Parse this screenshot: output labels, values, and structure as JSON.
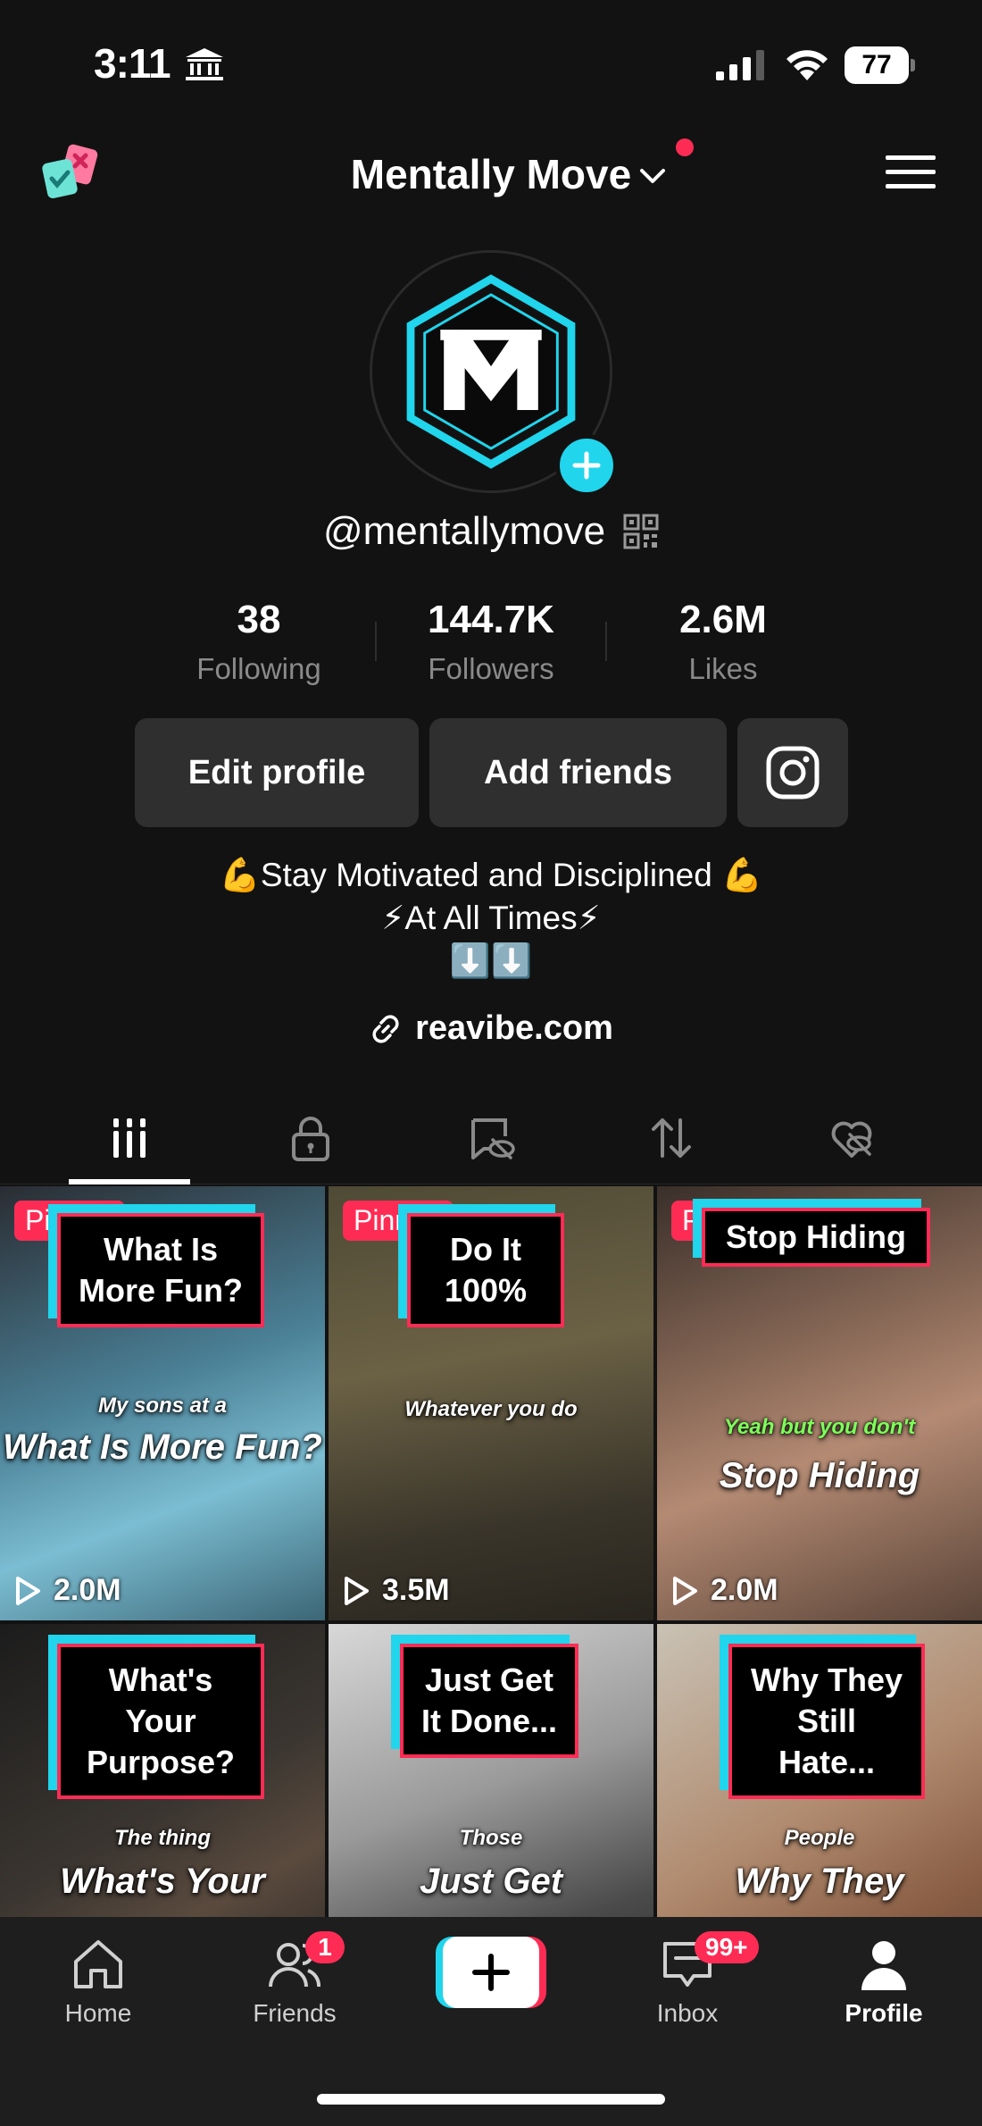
{
  "status_bar": {
    "time": "3:11",
    "battery": "77"
  },
  "header": {
    "account_name": "Mentally Move"
  },
  "profile": {
    "username": "@mentallymove",
    "stats": [
      {
        "value": "38",
        "label": "Following"
      },
      {
        "value": "144.7K",
        "label": "Followers"
      },
      {
        "value": "2.6M",
        "label": "Likes"
      }
    ],
    "edit_label": "Edit profile",
    "add_friends_label": "Add friends",
    "bio_lines": [
      "💪Stay Motivated and Disciplined 💪",
      "⚡At All Times⚡",
      "⬇️⬇️"
    ],
    "link": "reavibe.com"
  },
  "tabs": [
    "videos",
    "private",
    "reposts-hidden",
    "reposts",
    "liked"
  ],
  "videos": [
    {
      "pinned": "Pinned",
      "title": "What Is More Fun?",
      "caption_small": "My sons at a",
      "caption_big": "What Is More Fun?",
      "views": "2.0M"
    },
    {
      "pinned": "Pinned",
      "title": "Do It 100%",
      "caption_small": "Whatever you do",
      "caption_big": "",
      "views": "3.5M"
    },
    {
      "pinned": "Pinned",
      "title": "Stop Hiding",
      "caption_small": "Yeah but you don't",
      "caption_big": "Stop Hiding",
      "views": "2.0M"
    },
    {
      "pinned": "",
      "title": "What's Your Purpose?",
      "caption_small": "The thing",
      "caption_big": "What's Your",
      "views": ""
    },
    {
      "pinned": "",
      "title": "Just Get It Done...",
      "caption_small": "Those",
      "caption_big": "Just Get",
      "views": ""
    },
    {
      "pinned": "",
      "title": "Why They Still Hate...",
      "caption_small": "People",
      "caption_big": "Why They",
      "views": ""
    }
  ],
  "bottom_nav": {
    "home": "Home",
    "friends": "Friends",
    "friends_badge": "1",
    "inbox": "Inbox",
    "inbox_badge": "99+",
    "profile": "Profile"
  },
  "colors": {
    "accent_red": "#fe2c55",
    "accent_cyan": "#20d5ec",
    "background": "#121212"
  }
}
